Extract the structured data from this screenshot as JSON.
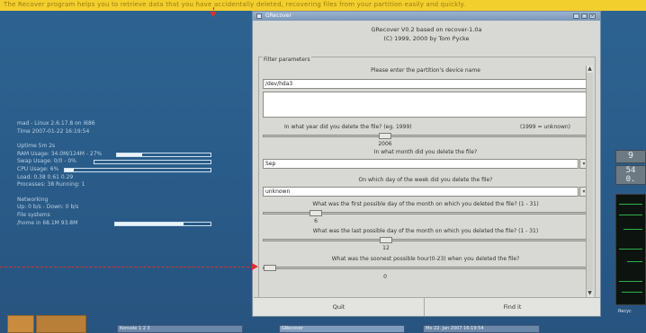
{
  "caption": "The Recover program helps you to retrieve data that you have accidentally deleted, recovering files from your partition easily and quickly.",
  "conky": {
    "host_line": "mad - Linux 2.6.17.8 on i686",
    "time_line": "Time 2007-01-22 16:19:54",
    "uptime_line": "Uptime 5m 2s",
    "ram_label": "RAM Usage: 34.0M/124M - 27%",
    "ram_level": 0.27,
    "swap_label": "Swap Usage: 0/0 - 0%",
    "swap_level": 0.0,
    "cpu_label": "CPU Usage: 6%",
    "cpu_level": 0.06,
    "load_line": "Load: 0.38 0.61 0.29",
    "processes_line": "Processes: 38  Running: 1",
    "networking_label": "Networking",
    "net_line": "Up: 0 b/s - Down: 0 b/s",
    "filesystems_label": "File systems",
    "fs_label": "/home  in 68.1M 93.8M",
    "fs_level": 0.72
  },
  "window": {
    "title": "GRecover",
    "header_line1": "GRecover V0.2 based on recover-1.0a",
    "header_line2": "(C) 1999, 2000 by Tom Pycke",
    "panel_label": "Filter parameters",
    "q_device": "Please enter the partition's device name",
    "device_value": "/dev/hda3",
    "q_year": "In what year did you delete the file? (eg. 1999)",
    "year_hint": "(1999 = unknown)",
    "year_value": "2006",
    "q_month": "In what month did you delete the file?",
    "month_value": "Sep",
    "q_weekday": "On which day of the week did you delete the file?",
    "weekday_value": "unknown",
    "q_first_day": "What was the first possible day of the month on which you deleted the file? (1 - 31)",
    "first_day_value": "6",
    "q_last_day": "What was the last possible day of the month on which you deleted the file? (1 - 31)",
    "last_day_value": "12",
    "q_hour": "What was the soonest possible hour(0-23) when you deleted the file?",
    "hour_value": "0",
    "quit_label": "Quit",
    "find_label": "Find it"
  },
  "widgets": {
    "clock_1": "9",
    "clock_2": "54",
    "clock_3": "0.",
    "graph_label": "Recyc"
  },
  "taskbar": {
    "item_1": "Konsole 1 2 3",
    "item_2": "GRecover",
    "item_3": "Mo 22. Jan 2007 16:19:54"
  },
  "colors": {
    "accent": "#f3cf2e",
    "arrow": "#e0302a",
    "desktop": "#2c5f8e"
  }
}
